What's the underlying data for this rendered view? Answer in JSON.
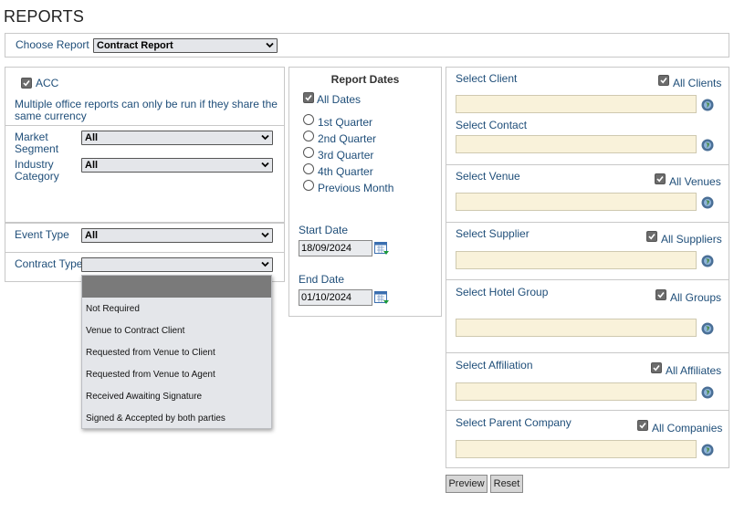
{
  "page": {
    "title": "REPORTS"
  },
  "choose_report": {
    "label": "Choose Report",
    "value": "Contract Report"
  },
  "left": {
    "acc_label": "ACC",
    "acc_checked": true,
    "multi_office_note": "Multiple office reports can only be run if they share the same currency",
    "market_segment": {
      "label": "Market Segment",
      "value": "All"
    },
    "industry_category": {
      "label": "Industry Category",
      "value": "All"
    },
    "event_type": {
      "label": "Event Type",
      "value": "All"
    },
    "contract_type": {
      "label": "Contract Type",
      "value": "",
      "options": [
        "",
        "Not Required",
        "Venue to Contract Client",
        "Requested from Venue to Client",
        "Requested from Venue to Agent",
        "Received Awaiting Signature",
        "Signed & Accepted by both parties"
      ]
    }
  },
  "dates": {
    "heading": "Report Dates",
    "all_dates_label": "All Dates",
    "all_dates_checked": true,
    "options": [
      "1st Quarter",
      "2nd Quarter",
      "3rd Quarter",
      "4th Quarter",
      "Previous Month"
    ],
    "start_label": "Start Date",
    "start_value": "18/09/2024",
    "end_label": "End Date",
    "end_value": "01/10/2024"
  },
  "right": {
    "client": {
      "label": "Select Client",
      "all_label": "All Clients",
      "checked": true
    },
    "contact": {
      "label": "Select Contact"
    },
    "venue": {
      "label": "Select Venue",
      "all_label": "All Venues",
      "checked": true
    },
    "supplier": {
      "label": "Select Supplier",
      "all_label": "All Suppliers",
      "checked": true
    },
    "hotel_group": {
      "label": "Select Hotel Group",
      "all_label": "All Groups",
      "checked": true
    },
    "affiliation": {
      "label": "Select Affiliation",
      "all_label": "All Affiliates",
      "checked": true
    },
    "parent_company": {
      "label": "Select Parent Company",
      "all_label": "All Companies",
      "checked": true
    }
  },
  "buttons": {
    "preview": "Preview",
    "reset": "Reset"
  },
  "icons": {
    "dropdown": "chevron-down-icon",
    "lookup": "globe-icon",
    "calendar": "calendar-icon",
    "checkbox": "check-icon"
  },
  "colors": {
    "label": "#1f4e79",
    "lookup_bg": "#f9f2da",
    "selected_option": "#7a7a7a"
  }
}
